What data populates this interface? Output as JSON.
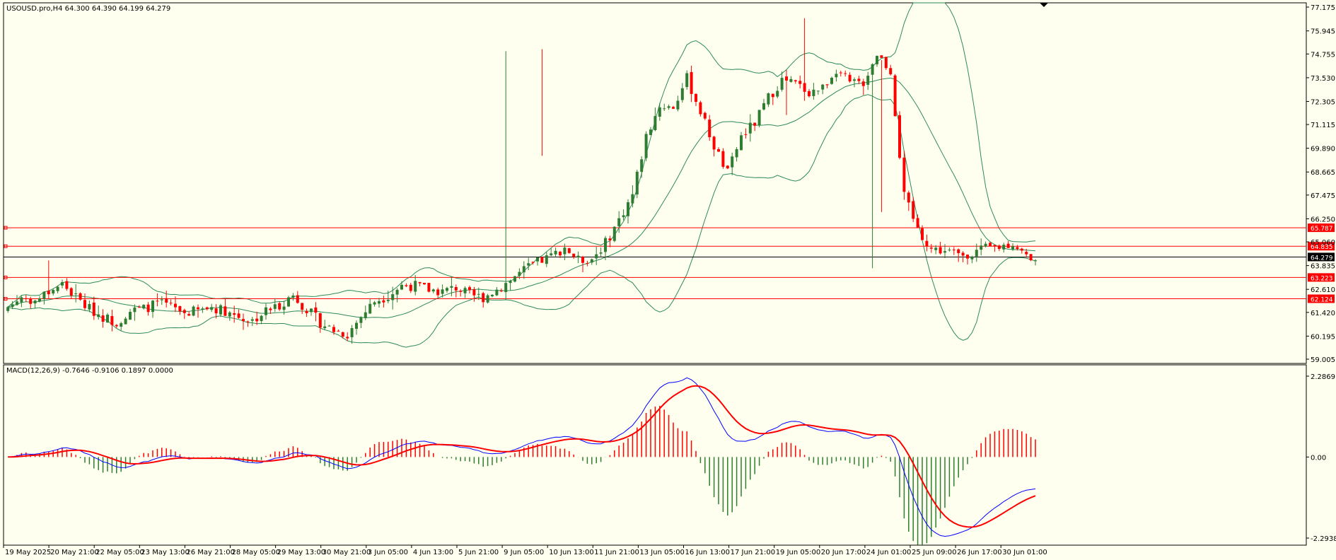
{
  "header": {
    "symbol_line": "USOUSD.pro,H4  64.300 64.390 64.199 64.279",
    "macd_line": "MACD(12,26,9) -0.7646 -0.9106 0.1897 0.0000"
  },
  "colors": {
    "background": "#fffff0",
    "bull": "#2e7d32",
    "bear": "#ff0000",
    "bands": "#2e8b57",
    "level": "#ff0000",
    "current": "#000000",
    "macd": "#0000ff",
    "signal": "#ff0000"
  },
  "chart_data": [
    {
      "type": "candlestick",
      "symbol": "USOUSD.pro",
      "timeframe": "H4",
      "ohlc_last": {
        "open": 64.3,
        "high": 64.39,
        "low": 64.199,
        "close": 64.279
      },
      "ylim": [
        59.005,
        77.175
      ],
      "y_ticks": [
        "77.175",
        "75.945",
        "74.755",
        "73.530",
        "72.305",
        "71.115",
        "69.890",
        "68.665",
        "67.475",
        "66.250",
        "65.060",
        "63.835",
        "62.610",
        "61.420",
        "60.195",
        "59.005"
      ],
      "current_price": "64.279",
      "horizontal_levels": [
        "65.787",
        "64.835",
        "63.223",
        "62.124"
      ],
      "x_ticks": [
        "19 May 2025",
        "20 May 21:00",
        "22 May 05:00",
        "23 May 13:00",
        "26 May 21:00",
        "28 May 05:00",
        "29 May 13:00",
        "30 May 21:00",
        "3 Jun 05:00",
        "4 Jun 13:00",
        "5 Jun 21:00",
        "9 Jun 05:00",
        "10 Jun 13:00",
        "11 Jun 21:00",
        "13 Jun 05:00",
        "16 Jun 13:00",
        "17 Jun 21:00",
        "19 Jun 05:00",
        "20 Jun 17:00",
        "24 Jun 01:00",
        "25 Jun 09:00",
        "26 Jun 17:00",
        "30 Jun 01:00"
      ],
      "indicator": "Bollinger Bands",
      "anchor_closes": [
        61.7,
        62.2,
        62.0,
        62.5,
        62.9,
        62.2,
        61.6,
        61.2,
        60.9,
        61.5,
        61.6,
        61.9,
        61.7,
        61.4,
        61.5,
        61.7,
        61.5,
        61.2,
        61.0,
        61.5,
        61.8,
        62.3,
        61.6,
        60.9,
        60.5,
        60.3,
        61.2,
        62.0,
        62.3,
        62.8,
        62.8,
        62.6,
        62.5,
        62.7,
        62.3,
        62.2,
        62.6,
        63.1,
        63.6,
        64.0,
        64.3,
        64.8,
        64.1,
        64.2,
        65.0,
        66.2,
        67.5,
        70.5,
        72.1,
        72.0,
        73.5,
        71.8,
        70.0,
        68.6,
        70.5,
        71.2,
        72.5,
        73.4,
        73.2,
        72.8,
        73.0,
        74.0,
        73.2,
        73.3,
        74.8,
        73.9,
        67.4,
        65.7,
        64.7,
        64.6,
        64.4,
        64.5,
        64.7,
        64.8,
        65.0,
        64.3,
        64.3
      ],
      "x_anchor_bar_indices": [
        0,
        3,
        6,
        9,
        12,
        15,
        18,
        21,
        24,
        27,
        30,
        33,
        36,
        39,
        42,
        45,
        48,
        51,
        54,
        57,
        60,
        63,
        66,
        69,
        72,
        75,
        78,
        81,
        84,
        87,
        90,
        93,
        96,
        99,
        102,
        105,
        108,
        111,
        114,
        117,
        120,
        123,
        126,
        129,
        132,
        135,
        138,
        141,
        144,
        147,
        150,
        153,
        156,
        159,
        162,
        165,
        168,
        171,
        174,
        177,
        180,
        183,
        186,
        189,
        192,
        195,
        198,
        201,
        204,
        207,
        210,
        213,
        216,
        219,
        222,
        225,
        227
      ]
    },
    {
      "type": "macd",
      "title": "MACD(12,26,9)",
      "values": {
        "macd": -0.7646,
        "signal": -0.9106,
        "histogram": 0.1897,
        "extra": 0.0
      },
      "ylim": [
        -2.2938,
        2.2869
      ],
      "y_ticks": [
        "2.2869",
        "0.00",
        "-2.2938"
      ]
    }
  ]
}
